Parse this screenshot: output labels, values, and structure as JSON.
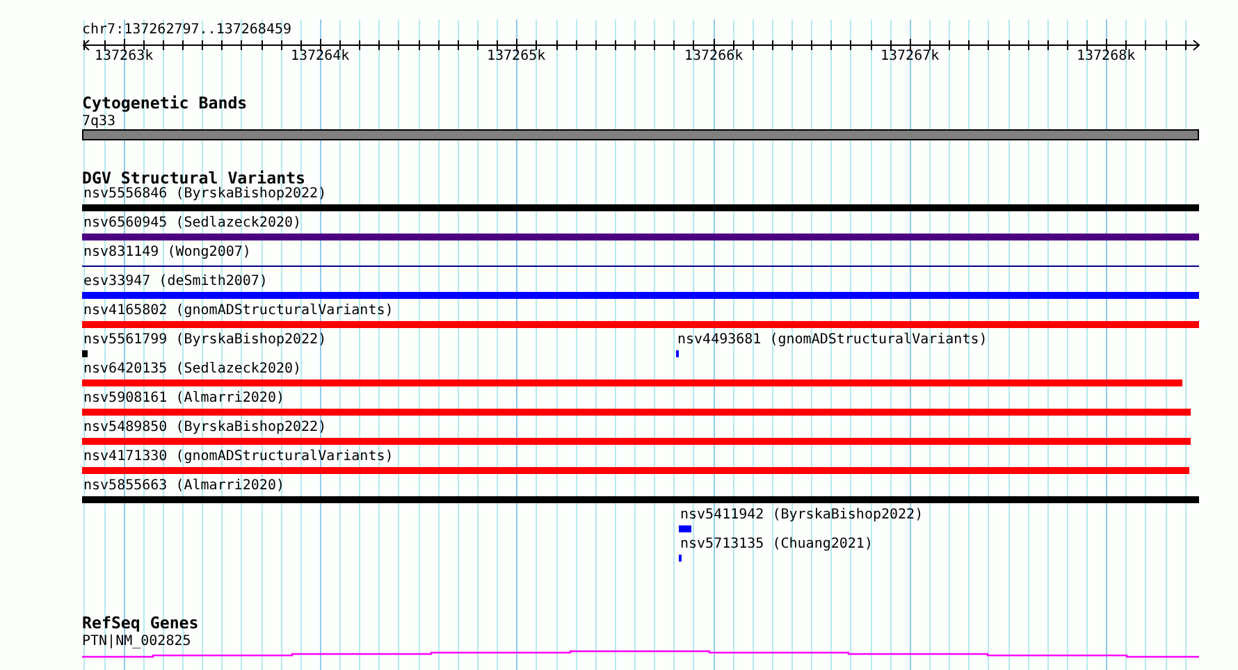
{
  "ruler": {
    "location": "chr7:137262797..137268459",
    "ticks": [
      "137263k",
      "137264k",
      "137265k",
      "137266k",
      "137267k",
      "137268k"
    ]
  },
  "cytogenetic_bands": {
    "title": "Cytogenetic Bands",
    "features": [
      {
        "label": "7q33"
      }
    ]
  },
  "dgv_structural_variants": {
    "title": "DGV Structural Variants",
    "rows": [
      {
        "features": [
          {
            "label": "nsv5556846 (ByrskaBishop2022)",
            "kind": "bar",
            "color": "#000000"
          }
        ]
      },
      {
        "features": [
          {
            "label": "nsv6560945 (Sedlazeck2020)",
            "kind": "bar",
            "color": "#4b0082"
          }
        ]
      },
      {
        "features": [
          {
            "label": "nsv831149 (Wong2007)",
            "kind": "line",
            "color": "#00008b"
          }
        ]
      },
      {
        "features": [
          {
            "label": "esv33947 (deSmith2007)",
            "kind": "bar",
            "color": "#0000ff"
          }
        ]
      },
      {
        "features": [
          {
            "label": "nsv4165802 (gnomADStructuralVariants)",
            "kind": "bar",
            "color": "#ff0000"
          }
        ]
      },
      {
        "features": [
          {
            "label": "nsv5561799 (ByrskaBishop2022)",
            "kind": "bar",
            "color": "#000000"
          },
          {
            "label": "nsv4493681 (gnomADStructuralVariants)",
            "kind": "bar",
            "color": "#0000ff"
          }
        ]
      },
      {
        "features": [
          {
            "label": "nsv6420135 (Sedlazeck2020)",
            "kind": "bar",
            "color": "#ff0000"
          }
        ]
      },
      {
        "features": [
          {
            "label": "nsv5908161 (Almarri2020)",
            "kind": "bar",
            "color": "#ff0000"
          }
        ]
      },
      {
        "features": [
          {
            "label": "nsv5489850 (ByrskaBishop2022)",
            "kind": "bar",
            "color": "#ff0000"
          }
        ]
      },
      {
        "features": [
          {
            "label": "nsv4171330 (gnomADStructuralVariants)",
            "kind": "bar",
            "color": "#ff0000"
          }
        ]
      },
      {
        "features": [
          {
            "label": "nsv5855663 (Almarri2020)",
            "kind": "bar",
            "color": "#000000"
          }
        ]
      },
      {
        "features": [
          {
            "label": "nsv5411942 (ByrskaBishop2022)",
            "kind": "bar",
            "color": "#0000ff"
          }
        ]
      },
      {
        "features": [
          {
            "label": "nsv5713135 (Chuang2021)",
            "kind": "bar",
            "color": "#0000ff"
          }
        ]
      }
    ]
  },
  "refseq_genes": {
    "title": "RefSeq Genes",
    "features": [
      {
        "label": "PTN|NM_002825"
      }
    ]
  }
}
